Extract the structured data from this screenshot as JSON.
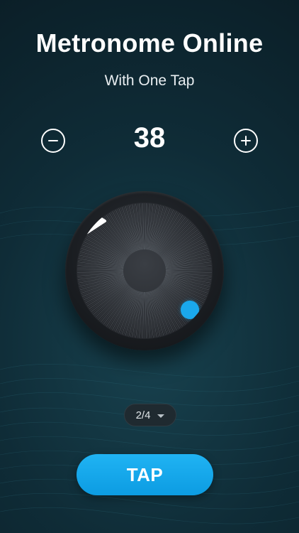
{
  "header": {
    "title": "Metronome Online",
    "subtitle": "With One Tap"
  },
  "tempo": {
    "bpm": "38",
    "decrease_icon": "minus-circle-icon",
    "increase_icon": "plus-circle-icon"
  },
  "dial": {
    "play_icon": "play-icon",
    "indicator_color": "#1aa8ec"
  },
  "time_signature": {
    "selected": "2/4",
    "icon": "caret-down-icon"
  },
  "tap_button": {
    "label": "TAP",
    "color": "#14a6ea"
  },
  "colors": {
    "accent": "#14a6ea",
    "background": "#0f2c37"
  }
}
